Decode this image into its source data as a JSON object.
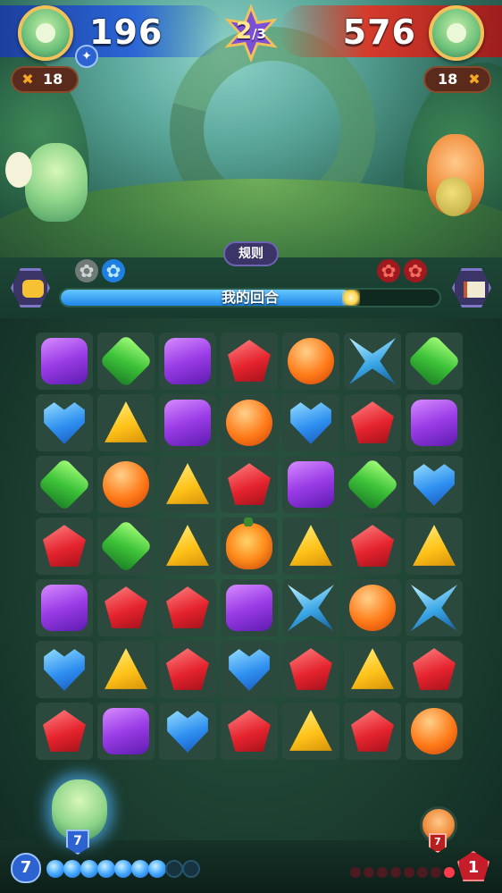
{
  "header": {
    "player_score": "196",
    "opponent_score": "576",
    "round_current": "2",
    "round_total": "/3",
    "player_moves": "18",
    "opponent_moves": "18"
  },
  "rules_button_label": "规则",
  "turn": {
    "label": "我的回合",
    "progress": 0.76
  },
  "paws": {
    "player": [
      "gray",
      "blue"
    ],
    "opponent": [
      "red",
      "red"
    ]
  },
  "board": {
    "rows": 7,
    "cols": 7,
    "gems": [
      [
        "purple",
        "green",
        "purple",
        "red",
        "orange",
        "star",
        "green"
      ],
      [
        "blue",
        "yellow",
        "purple",
        "orange",
        "blue",
        "red",
        "purple"
      ],
      [
        "green",
        "orange",
        "yellow",
        "red",
        "purple",
        "green",
        "blue"
      ],
      [
        "red",
        "green",
        "yellow",
        "pumpkin",
        "yellow",
        "red",
        "yellow"
      ],
      [
        "purple",
        "red",
        "red",
        "purple",
        "star",
        "orange",
        "star"
      ],
      [
        "blue",
        "yellow",
        "red",
        "blue",
        "red",
        "yellow",
        "red"
      ],
      [
        "red",
        "purple",
        "blue",
        "red",
        "yellow",
        "red",
        "orange"
      ]
    ]
  },
  "bottom": {
    "player_hero_level": "7",
    "opponent_hero_level": "7",
    "player_mana": "7",
    "player_mana_max": 9,
    "opponent_mana": "1",
    "opponent_mana_max": 8
  },
  "icons": {
    "player_badge": "star-badge-icon",
    "moves": "pin-icon",
    "emote": "chat-emote-icon",
    "book": "book-icon"
  }
}
